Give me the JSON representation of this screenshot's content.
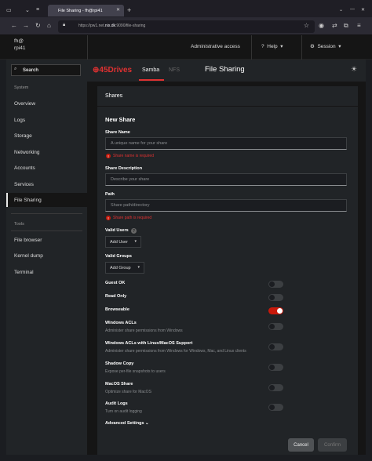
{
  "browser": {
    "tab_title": "File Sharing - fh@rpi41",
    "url_prefix": "https://pw1.net.",
    "url_domain": "nix.dk",
    "url_suffix": ":9090/file-sharing"
  },
  "header": {
    "user": "fh@",
    "host": "rpi41",
    "admin_access": "Administrative access",
    "help": "Help",
    "session": "Session"
  },
  "sidebar": {
    "search_placeholder": "Search",
    "system_heading": "System",
    "items": [
      "Overview",
      "Logs",
      "Storage",
      "Networking",
      "Accounts",
      "Services",
      "File Sharing"
    ],
    "tools_heading": "Tools",
    "tools": [
      "File browser",
      "Kernel dump",
      "Terminal"
    ]
  },
  "app": {
    "brand_prefix": "45",
    "brand_suffix": "Drives",
    "tabs": [
      "Samba",
      "NFS"
    ],
    "title": "File Sharing"
  },
  "form": {
    "card_title": "Shares",
    "section_title": "New Share",
    "share_name_label": "Share Name",
    "share_name_placeholder": "A unique name for your share",
    "share_name_error": "Share name is required",
    "desc_label": "Share Description",
    "desc_placeholder": "Describe your share",
    "path_label": "Path",
    "path_placeholder": "Share path/directory",
    "path_error": "Share path is required",
    "valid_users_label": "Valid Users",
    "add_user": "Add User",
    "valid_groups_label": "Valid Groups",
    "add_group": "Add Group",
    "toggles": [
      {
        "label": "Guest OK",
        "sub": "",
        "on": false
      },
      {
        "label": "Read Only",
        "sub": "",
        "on": false
      },
      {
        "label": "Browseable",
        "sub": "",
        "on": true
      },
      {
        "label": "Windows ACLs",
        "sub": "Administer share permissions from Windows",
        "on": false
      },
      {
        "label": "Windows ACLs with Linux/MacOS Support",
        "sub": "Administer share permissions from Windows for Windows, Mac, and Linux clients",
        "on": false
      },
      {
        "label": "Shadow Copy",
        "sub": "Expose per-file snapshots to users",
        "on": false
      },
      {
        "label": "MacOS Share",
        "sub": "Optimize share for MacOS",
        "on": false
      },
      {
        "label": "Audit Logs",
        "sub": "Turn on audit logging",
        "on": false
      }
    ],
    "advanced": "Advanced Settings",
    "cancel": "Cancel",
    "confirm": "Confirm"
  }
}
